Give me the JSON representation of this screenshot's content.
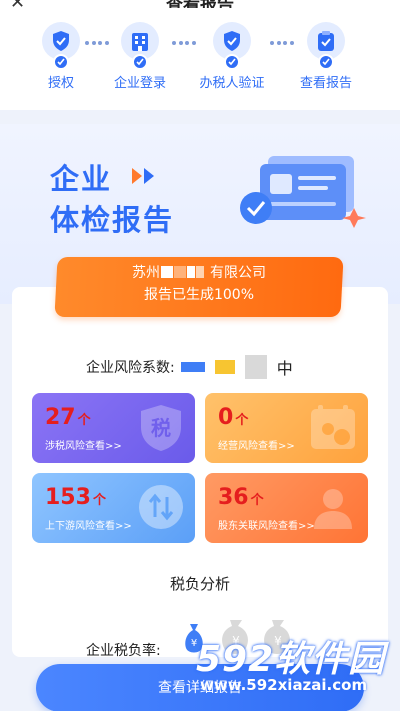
{
  "header": {
    "title": "查看报告",
    "back_icon": "close-icon"
  },
  "steps": [
    {
      "label": "授权",
      "icon": "shield-icon"
    },
    {
      "label": "企业登录",
      "icon": "building-icon"
    },
    {
      "label": "办税人验证",
      "icon": "shield-check-icon"
    },
    {
      "label": "查看报告",
      "icon": "clipboard-check-icon"
    }
  ],
  "hero": {
    "line1": "企业",
    "line2": "体检报告"
  },
  "banner": {
    "company_prefix": "苏州",
    "company_suffix": "有限公司",
    "status": "报告已生成100%"
  },
  "risk": {
    "label": "企业风险系数:",
    "level": "中",
    "colors": [
      "#3f7ef6",
      "#f7c531",
      "#d9d9d9"
    ]
  },
  "tiles": [
    {
      "count": "27",
      "unit": "个",
      "link": "涉税风险查看>>",
      "deco": "税",
      "colors": [
        "#8b74f5",
        "#6a5bea"
      ]
    },
    {
      "count": "0",
      "unit": "个",
      "link": "经营风险查看>>",
      "colors": [
        "#ffc26b",
        "#ffa23d"
      ]
    },
    {
      "count": "153",
      "unit": "个",
      "link": "上下游风险查看>>",
      "colors": [
        "#8fc5ff",
        "#5b9ff7"
      ]
    },
    {
      "count": "36",
      "unit": "个",
      "link": "股东关联风险查看>>",
      "colors": [
        "#ff9a64",
        "#ff7435"
      ]
    }
  ],
  "tax": {
    "section_title": "税负分析",
    "rate_label": "企业税负率:"
  },
  "button": {
    "label": "查看详细报告"
  },
  "watermark": {
    "brand": "592软件园",
    "url": "www.592xiazai.com"
  }
}
